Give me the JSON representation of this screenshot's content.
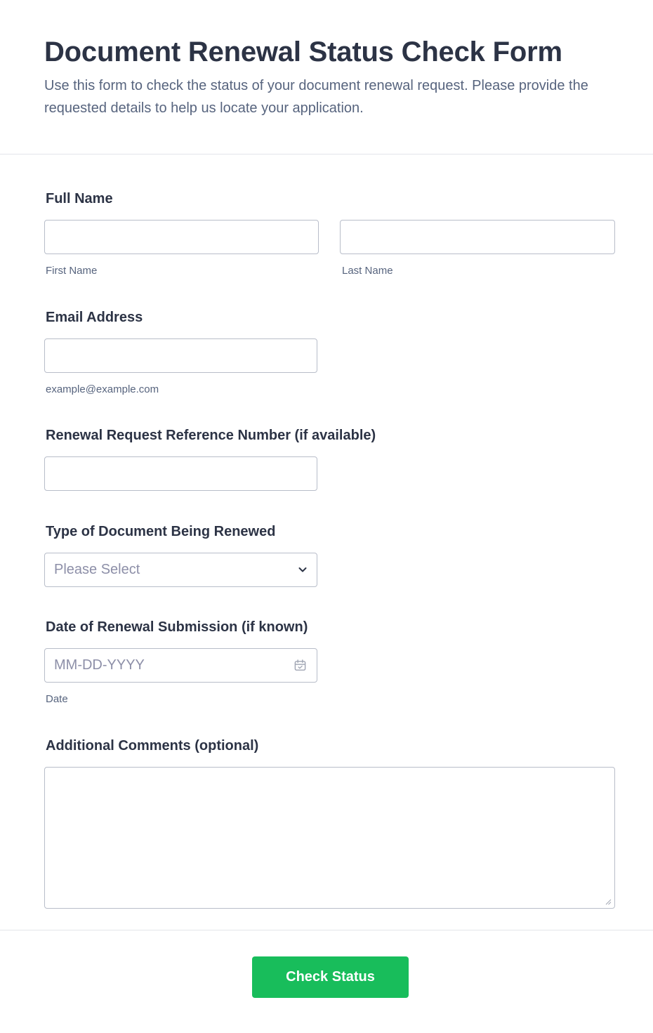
{
  "header": {
    "title": "Document Renewal Status Check Form",
    "subtitle": "Use this form to check the status of your document renewal request. Please provide the requested details to help us locate your application."
  },
  "fields": {
    "full_name": {
      "label": "Full Name",
      "first_sublabel": "First Name",
      "last_sublabel": "Last Name",
      "first_value": "",
      "last_value": ""
    },
    "email": {
      "label": "Email Address",
      "sublabel": "example@example.com",
      "value": ""
    },
    "reference": {
      "label": "Renewal Request Reference Number (if available)",
      "value": ""
    },
    "doc_type": {
      "label": "Type of Document Being Renewed",
      "selected": "Please Select",
      "icon": "chevron-down-icon"
    },
    "submission_date": {
      "label": "Date of Renewal Submission (if known)",
      "placeholder": "MM-DD-YYYY",
      "sublabel": "Date",
      "icon": "calendar-icon"
    },
    "comments": {
      "label": "Additional Comments (optional)",
      "value": ""
    }
  },
  "submit": {
    "label": "Check Status"
  },
  "colors": {
    "accent": "#18bd5b",
    "text": "#2c3345",
    "muted": "#57647e",
    "placeholder": "#8d8fa8",
    "border": "#b8bdc9"
  }
}
